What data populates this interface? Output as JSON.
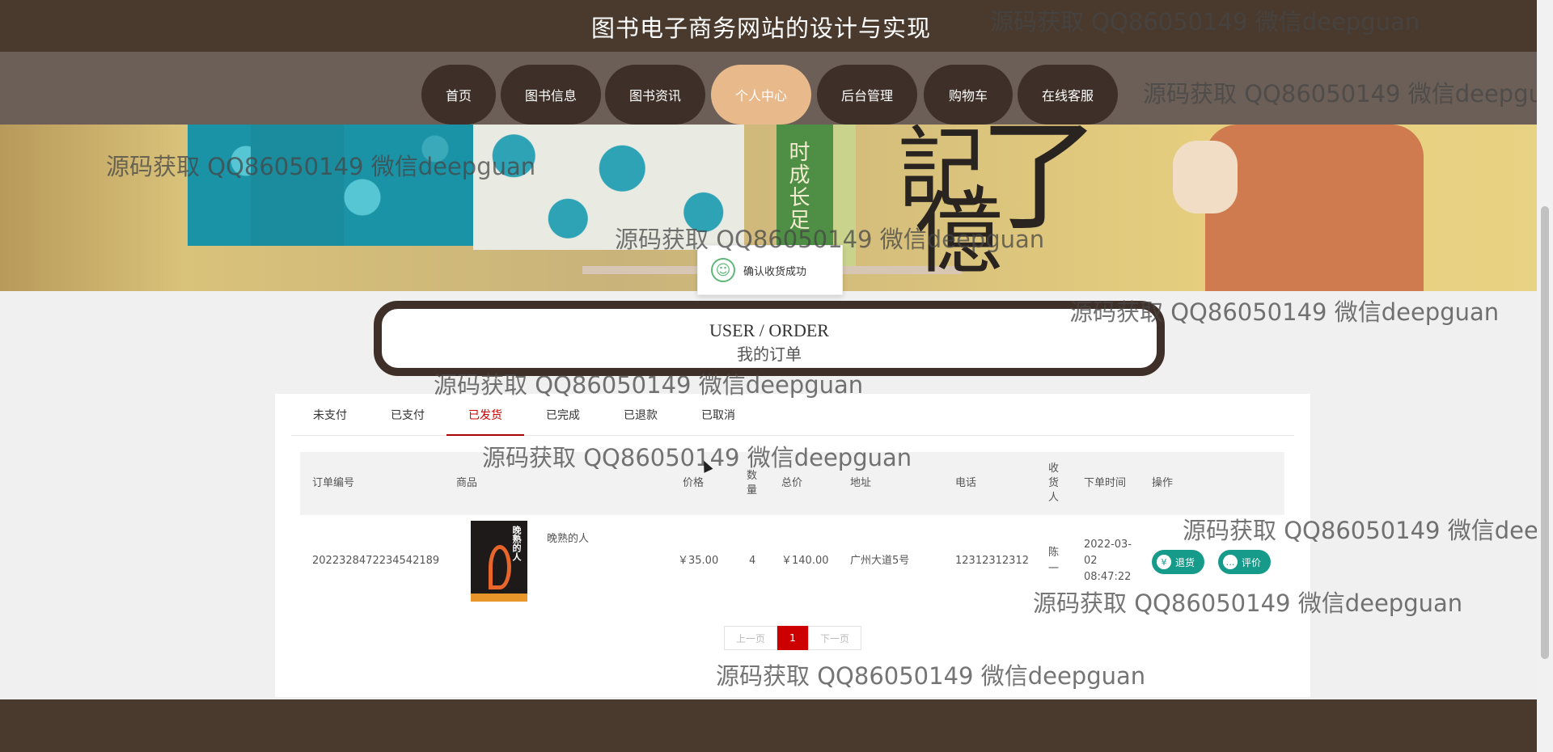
{
  "header": {
    "title": "图书电子商务网站的设计与实现"
  },
  "nav": {
    "items": [
      {
        "label": "首页"
      },
      {
        "label": "图书信息"
      },
      {
        "label": "图书资讯"
      },
      {
        "label": "个人中心"
      },
      {
        "label": "后台管理"
      },
      {
        "label": "购物车"
      },
      {
        "label": "在线客服"
      }
    ],
    "active": "个人中心"
  },
  "banner": {
    "vertical_text": "时成长足",
    "calligraphy": [
      "記",
      "了",
      "億"
    ]
  },
  "toast": {
    "icon": "smile-icon",
    "message": "确认收货成功"
  },
  "section": {
    "title_en": "USER / ORDER",
    "title_cn": "我的订单"
  },
  "tabs": {
    "items": [
      {
        "label": "未支付"
      },
      {
        "label": "已支付"
      },
      {
        "label": "已发货"
      },
      {
        "label": "已完成"
      },
      {
        "label": "已退款"
      },
      {
        "label": "已取消"
      }
    ],
    "active": "已发货"
  },
  "table": {
    "headers": {
      "order_no": "订单编号",
      "product": "商品",
      "price": "价格",
      "qty": "数量",
      "total": "总价",
      "address": "地址",
      "phone": "电话",
      "receiver": "收货人",
      "time": "下单时间",
      "ops": "操作"
    },
    "rows": [
      {
        "order_no": "2022328472234542189",
        "book_name": "晚熟的人",
        "cover_text": "晚熟的人",
        "price": "￥35.00",
        "qty": "4",
        "total": "￥140.00",
        "address": "广州大道5号",
        "phone": "12312312312",
        "receiver": "陈一",
        "time": "2022-03-02 08:47:22",
        "actions": {
          "refund": "退货",
          "review": "评价"
        }
      }
    ]
  },
  "pager": {
    "prev": "上一页",
    "current": "1",
    "next": "下一页"
  },
  "watermark": "源码获取 QQ86050149 微信deepguan",
  "colors": {
    "header_bg": "#4a3a2e",
    "nav_bg": "#6b5f57",
    "nav_active": "#e8b98a",
    "tab_active": "#cc0000",
    "action_btn": "#169a8a"
  }
}
